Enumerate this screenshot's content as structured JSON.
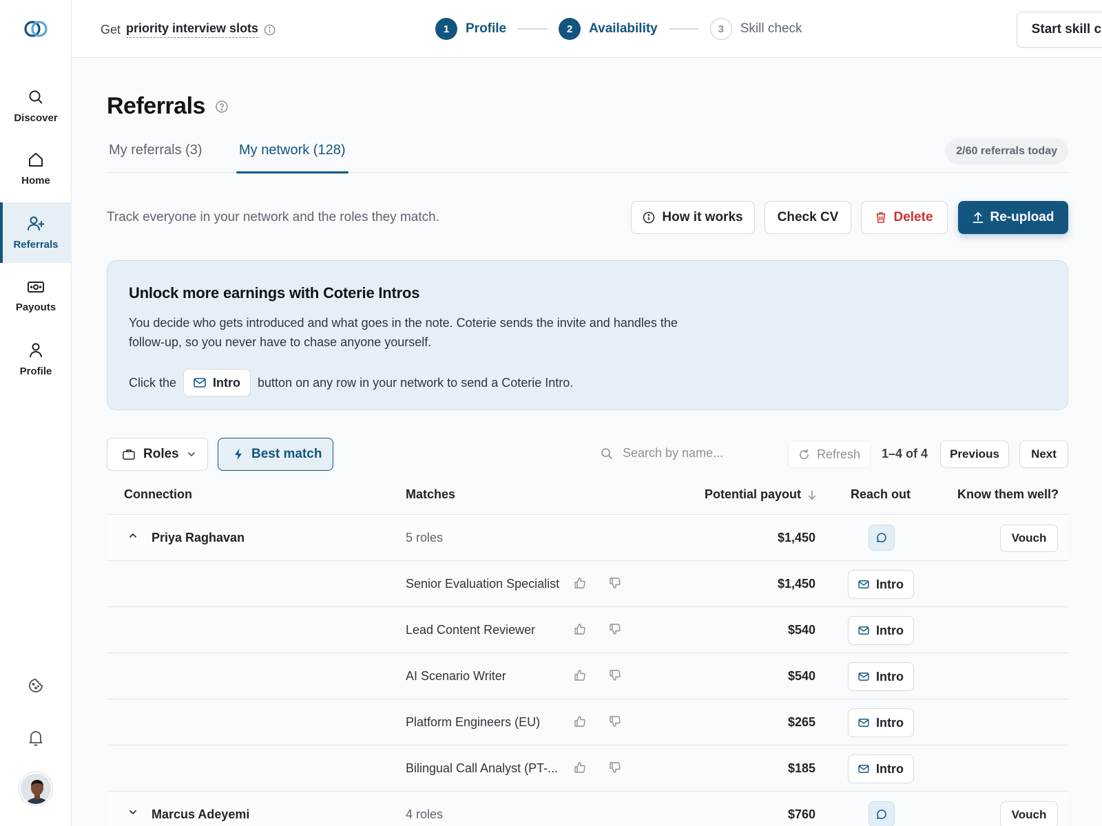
{
  "topbar": {
    "promo_prefix": "Get",
    "promo_strong": "priority interview slots",
    "steps": [
      {
        "num": "1",
        "label": "Profile"
      },
      {
        "num": "2",
        "label": "Availability"
      },
      {
        "num": "3",
        "label": "Skill check"
      }
    ],
    "cta": "Start skill check"
  },
  "sidebar": {
    "items": [
      {
        "label": "Discover",
        "icon": "search-icon"
      },
      {
        "label": "Home",
        "icon": "home-icon"
      },
      {
        "label": "Referrals",
        "icon": "user-plus-icon"
      },
      {
        "label": "Payouts",
        "icon": "cash-icon"
      },
      {
        "label": "Profile",
        "icon": "user-icon"
      }
    ]
  },
  "page": {
    "title": "Referrals",
    "tabs": [
      "My referrals (3)",
      "My network (128)"
    ],
    "quota": "2/60 referrals today",
    "subline": "Track everyone in your network and the roles they match.",
    "actions": {
      "how": "How it works",
      "cv": "Check CV",
      "delete": "Delete",
      "reupload": "Re-upload"
    }
  },
  "banner": {
    "title": "Unlock more earnings with Coterie Intros",
    "body": "You decide who gets introduced and what goes in the note. Coterie sends the invite and handles the follow-up, so you never have to chase anyone yourself.",
    "hint_before": "Click the",
    "hint_chip": "Intro",
    "hint_after": "button on any row in your network to send a Coterie Intro."
  },
  "filters": {
    "roles": "Roles",
    "best": "Best match",
    "search_placeholder": "Search by name...",
    "refresh": "Refresh",
    "range": "1–4 of 4",
    "prev": "Previous",
    "next": "Next"
  },
  "table": {
    "headers": {
      "connection": "Connection",
      "matches": "Matches",
      "payout": "Potential payout",
      "reach": "Reach out",
      "know": "Know them well?"
    },
    "intro_label": "Intro",
    "vouch_label": "Vouch",
    "people": [
      {
        "name": "Priya Raghavan",
        "roles": "5 roles",
        "payout": "$1,450",
        "matches": [
          {
            "role": "Senior Evaluation Specialist",
            "payout": "$1,450"
          },
          {
            "role": "Lead Content Reviewer",
            "payout": "$540"
          },
          {
            "role": "AI Scenario Writer",
            "payout": "$540"
          },
          {
            "role": "Platform Engineers (EU)",
            "payout": "$265"
          },
          {
            "role": "Bilingual Call Analyst (PT-...",
            "payout": "$185"
          }
        ]
      },
      {
        "name": "Marcus Adeyemi",
        "roles": "4 roles",
        "payout": "$760"
      }
    ]
  },
  "colors": {
    "brand": "#12557f",
    "danger": "#c8322b",
    "banner_bg": "#e7eff6"
  }
}
